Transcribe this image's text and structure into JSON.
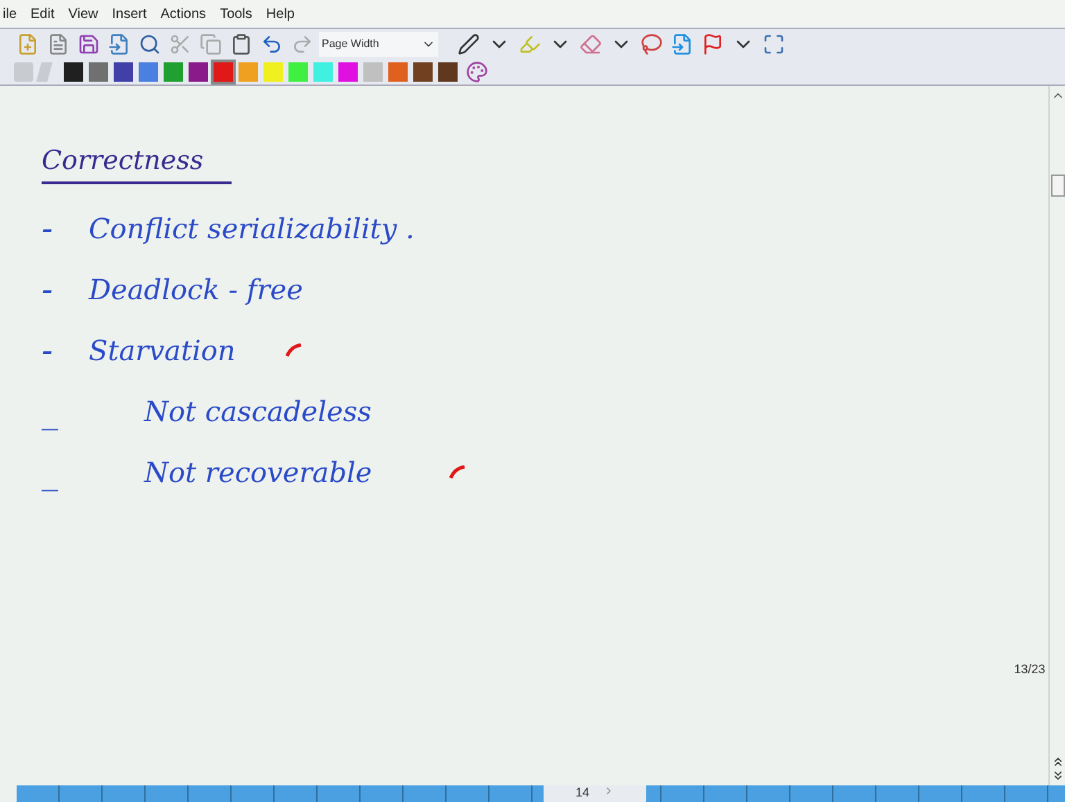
{
  "menu": [
    "ile",
    "Edit",
    "View",
    "Insert",
    "Actions",
    "Tools",
    "Help"
  ],
  "toolbar": {
    "zoom": "Page Width"
  },
  "palette": [
    {
      "color": "#202020",
      "selected": false
    },
    {
      "color": "#707070",
      "selected": false
    },
    {
      "color": "#4040a8",
      "selected": false
    },
    {
      "color": "#4a80e0",
      "selected": false
    },
    {
      "color": "#20a030",
      "selected": false
    },
    {
      "color": "#8a1a8a",
      "selected": false
    },
    {
      "color": "#e01818",
      "selected": true
    },
    {
      "color": "#f0a020",
      "selected": false
    },
    {
      "color": "#f0f020",
      "selected": false
    },
    {
      "color": "#40f040",
      "selected": false
    },
    {
      "color": "#40f0e0",
      "selected": false
    },
    {
      "color": "#e010e0",
      "selected": false
    },
    {
      "color": "#c0c0c0",
      "selected": false
    },
    {
      "color": "#e06020",
      "selected": false
    },
    {
      "color": "#704020",
      "selected": false
    },
    {
      "color": "#603820",
      "selected": false
    }
  ],
  "note": {
    "heading": "Correctness",
    "items": [
      {
        "dash": "-",
        "text": "Conflict serializability .",
        "ticked": false,
        "indent": false
      },
      {
        "dash": "-",
        "text": "Deadlock - free",
        "ticked": false,
        "indent": false
      },
      {
        "dash": "-",
        "text": "Starvation",
        "ticked": true,
        "indent": false
      },
      {
        "dash": "_",
        "text": "Not cascadeless",
        "ticked": false,
        "indent": true
      },
      {
        "dash": "_",
        "text": "Not recoverable",
        "ticked": true,
        "indent": true
      }
    ]
  },
  "page_counter": "13/23",
  "page_tab": "14"
}
